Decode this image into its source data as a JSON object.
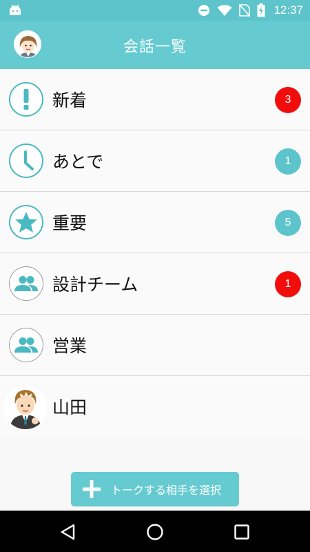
{
  "status_bar": {
    "time": "12:37",
    "icons": [
      "android-icon",
      "do-not-disturb-icon",
      "wifi-icon",
      "no-sim-icon",
      "battery-charging-icon"
    ]
  },
  "app_bar": {
    "title": "会話一覧",
    "avatar": "user-avatar"
  },
  "conversations": [
    {
      "label": "新着",
      "icon": "exclamation-icon",
      "badge": "3",
      "badge_color": "#f20d0d"
    },
    {
      "label": "あとで",
      "icon": "clock-icon",
      "badge": "1",
      "badge_color": "#5ec4cb"
    },
    {
      "label": "重要",
      "icon": "star-icon",
      "badge": "5",
      "badge_color": "#5ec4cb"
    },
    {
      "label": "設計チーム",
      "icon": "group-icon",
      "badge": "1",
      "badge_color": "#f20d0d"
    },
    {
      "label": "営業",
      "icon": "group-icon"
    },
    {
      "label": "山田",
      "icon": "person-avatar"
    }
  ],
  "new_talk_button": {
    "label": "トークする相手を選択",
    "icon": "plus-icon"
  },
  "nav_bar": {
    "buttons": [
      "back-icon",
      "home-icon",
      "recents-icon"
    ]
  },
  "colors": {
    "accent": "#66cbd1",
    "status_bar": "#5ec4cb",
    "badge_red": "#f20d0d",
    "badge_teal": "#5ec4cb",
    "icon_teal": "#4ab9c1"
  }
}
